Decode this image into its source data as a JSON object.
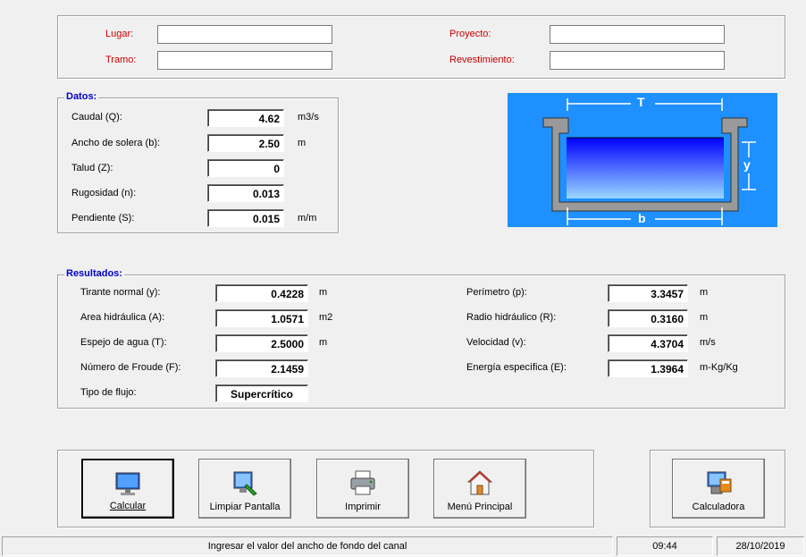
{
  "header": {
    "lugar_label": "Lugar:",
    "tramo_label": "Tramo:",
    "proyecto_label": "Proyecto:",
    "revestimiento_label": "Revestimiento:",
    "lugar_value": "",
    "tramo_value": "",
    "proyecto_value": "",
    "revestimiento_value": ""
  },
  "datos": {
    "title": "Datos:",
    "rows": [
      {
        "label": "Caudal (Q):",
        "value": "4.62",
        "unit": "m3/s"
      },
      {
        "label": "Ancho de solera (b):",
        "value": "2.50",
        "unit": "m"
      },
      {
        "label": "Talud (Z):",
        "value": "0",
        "unit": ""
      },
      {
        "label": "Rugosidad (n):",
        "value": "0.013",
        "unit": ""
      },
      {
        "label": "Pendiente (S):",
        "value": "0.015",
        "unit": "m/m"
      }
    ]
  },
  "diagram": {
    "top_label": "T",
    "side_label": "y",
    "bottom_label": "b"
  },
  "resultados": {
    "title": "Resultados:",
    "left": [
      {
        "label": "Tirante normal (y):",
        "value": "0.4228",
        "unit": "m"
      },
      {
        "label": "Area hidráulica (A):",
        "value": "1.0571",
        "unit": "m2"
      },
      {
        "label": "Espejo de agua (T):",
        "value": "2.5000",
        "unit": "m"
      },
      {
        "label": "Número de Froude (F):",
        "value": "2.1459",
        "unit": ""
      },
      {
        "label": "Tipo de flujo:",
        "value": "Supercrítico",
        "unit": ""
      }
    ],
    "right": [
      {
        "label": "Perímetro (p):",
        "value": "3.3457",
        "unit": "m"
      },
      {
        "label": "Radio hidráulico (R):",
        "value": "0.3160",
        "unit": "m"
      },
      {
        "label": "Velocidad (v):",
        "value": "4.3704",
        "unit": "m/s"
      },
      {
        "label": "Energía específica (E):",
        "value": "1.3964",
        "unit": "m-Kg/Kg"
      }
    ]
  },
  "buttons": {
    "calcular": "Calcular",
    "limpiar": "Limpiar Pantalla",
    "imprimir": "Imprimir",
    "menu": "Menú Principal",
    "calculadora": "Calculadora"
  },
  "status": {
    "message": "Ingresar el valor del ancho de fondo del canal",
    "time": "09:44",
    "date": "28/10/2019"
  },
  "colors": {
    "diagram_bg": "#1e90ff",
    "channel_wall": "#9a9a9a",
    "water_top": "#0000ff",
    "water_bottom": "#9ad8ff",
    "label_red": "#cc0000",
    "title_blue": "#0000cc"
  },
  "icons": {
    "calcular": "computer-monitor-icon",
    "limpiar": "clean-screen-icon",
    "imprimir": "printer-icon",
    "menu": "home-icon",
    "calculadora": "calculator-pc-icon"
  }
}
